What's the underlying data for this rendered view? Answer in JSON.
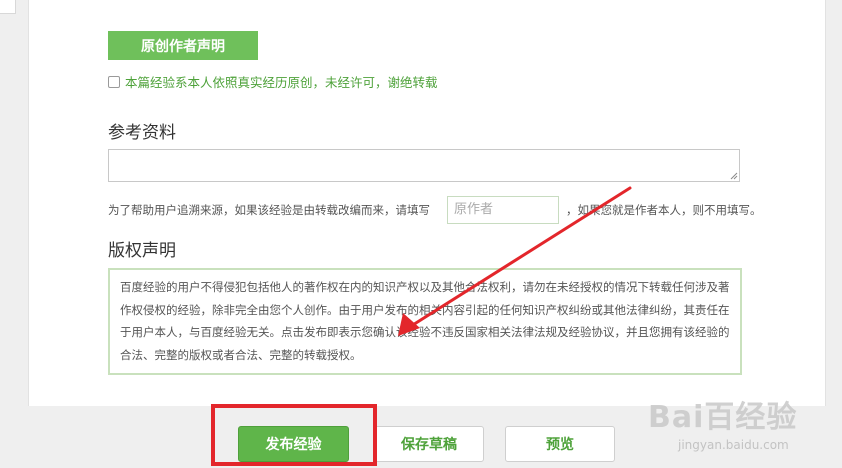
{
  "original_section": {
    "button_label": "原创作者声明",
    "checkbox_checked": false,
    "checkbox_label": "本篇经验系本人依照真实经历原创，未经许可，谢绝转载"
  },
  "references": {
    "title": "参考资料",
    "textarea_value": "",
    "help_text_before": "为了帮助用户追溯来源，如果该经验是由转载改编而来，请填写",
    "author_placeholder": "原作者",
    "help_text_after": "，如果您就是作者本人，则不用填写。"
  },
  "copyright": {
    "title": "版权声明",
    "text": "百度经验的用户不得侵犯包括他人的著作权在内的知识产权以及其他合法权利，请勿在未经授权的情况下转载任何涉及著作权侵权的经验，除非完全由您个人创作。由于用户发布的相关内容引起的任何知识产权纠纷或其他法律纠纷，其责任在于用户本人，与百度经验无关。点击发布即表示您确认该经验不违反国家相关法律法规及经验协议，并且您拥有该经验的合法、完整的版权或者合法、完整的转载授权。"
  },
  "actions": {
    "publish_label": "发布经验",
    "draft_label": "保存草稿",
    "preview_label": "预览"
  },
  "annotation_colors": {
    "highlight": "#e3262b",
    "arrow": "#e3262b"
  },
  "watermark": {
    "logo": "Bai百经验",
    "url": "jingyan.baidu.com"
  }
}
